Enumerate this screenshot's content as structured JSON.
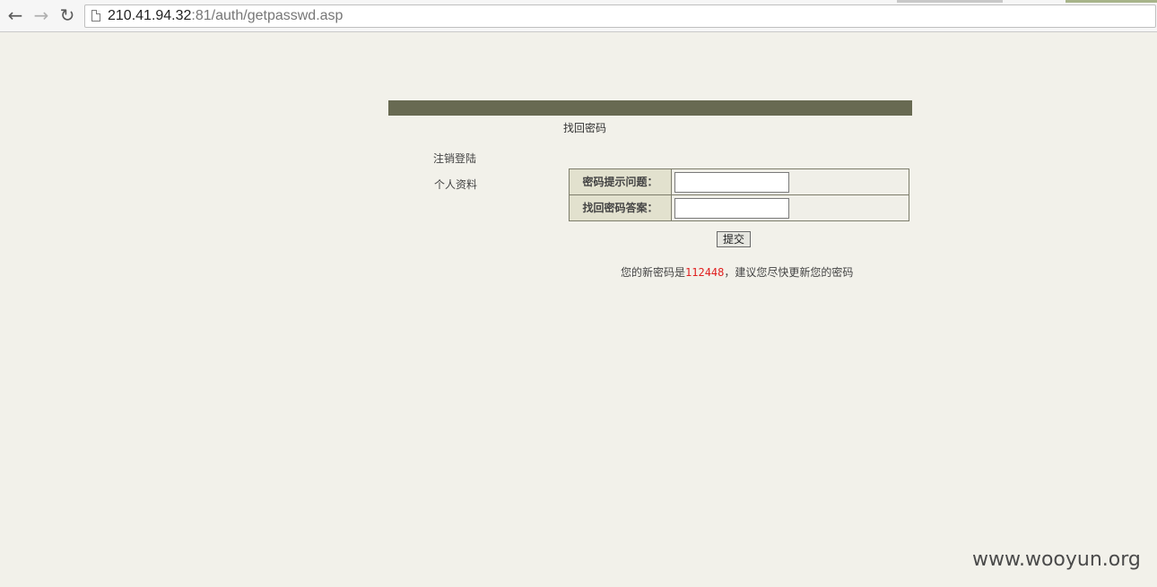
{
  "browser": {
    "back_icon": "arrow-left-icon",
    "forward_icon": "arrow-right-icon",
    "reload_icon": "reload-icon",
    "url_host": "210.41.94.32",
    "url_rest": ":81/auth/getpasswd.asp"
  },
  "page": {
    "title": "找回密码",
    "side_links": [
      "注销登陆",
      "个人资料"
    ],
    "form": {
      "question_label": "密码提示问题：",
      "question_value": "",
      "answer_label": "找回密码答案：",
      "answer_value": ""
    },
    "submit_label": "提交",
    "result_prefix": "您的新密码是",
    "new_password": "112448",
    "result_suffix": "，建议您尽快更新您的密码"
  },
  "watermark": "www.wooyun.org",
  "colors": {
    "page_bg": "#f2f1ea",
    "header_band": "#686a52",
    "label_bg": "#e2e1ce",
    "password_highlight": "#e02020"
  }
}
